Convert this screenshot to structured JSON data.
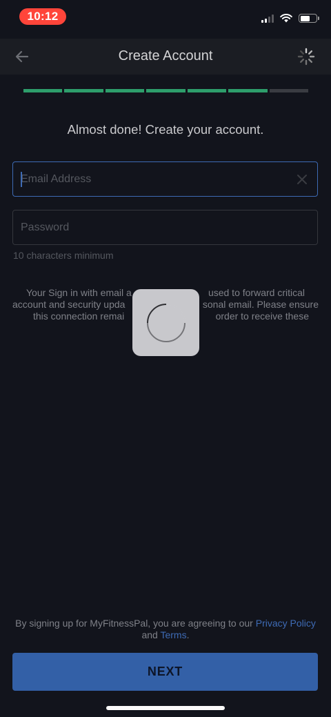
{
  "status_bar": {
    "time": "10:12",
    "signal_bars": 4,
    "signal_bars_active": 2,
    "battery_level": 0.6
  },
  "nav": {
    "title": "Create Account",
    "back_icon": "arrow-left-icon",
    "loading_icon": "spinner-icon"
  },
  "progress": {
    "total_steps": 7,
    "completed_steps": 6,
    "active_color": "#2e9e6b",
    "inactive_color": "#3a3c42"
  },
  "headline": "Almost done! Create your account.",
  "email": {
    "placeholder": "Email Address",
    "value": ""
  },
  "password": {
    "placeholder": "Password",
    "value": "",
    "hint": "10 characters minimum"
  },
  "info_lines": [
    "Your Sign in with email a",
    "used to forward critical",
    "account and security upda",
    "sonal email. Please ensure",
    "this connection remai",
    "order to receive these"
  ],
  "terms": {
    "prefix": "By signing up for MyFitnessPal, you are agreeing to our ",
    "privacy_link": "Privacy Policy",
    "middle": " and ",
    "terms_link": "Terms",
    "suffix": "."
  },
  "next_button": {
    "label": "NEXT",
    "color": "#3360a7"
  },
  "colors": {
    "background": "#12141c",
    "accent": "#3e6bb5"
  }
}
